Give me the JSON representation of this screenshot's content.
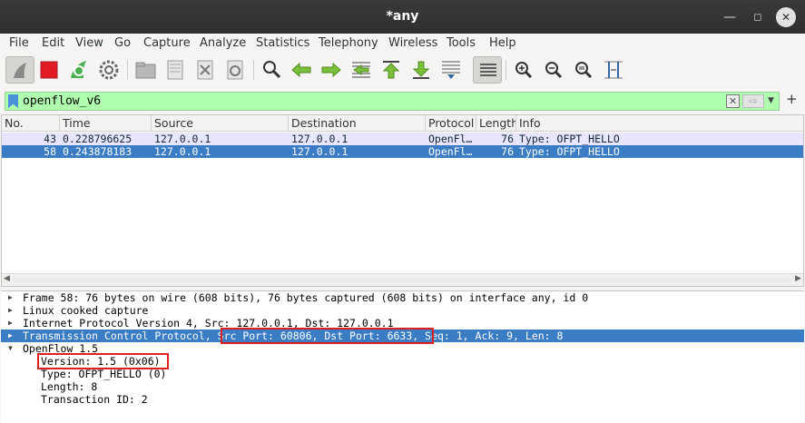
{
  "window": {
    "title": "*any"
  },
  "menu": [
    "File",
    "Edit",
    "View",
    "Go",
    "Capture",
    "Analyze",
    "Statistics",
    "Telephony",
    "Wireless",
    "Tools",
    "Help"
  ],
  "filter": {
    "value": "openflow_v6"
  },
  "packet_list": {
    "columns": [
      "No.",
      "Time",
      "Source",
      "Destination",
      "Protocol",
      "Length",
      "Info"
    ],
    "rows": [
      {
        "no": "43",
        "time": "0.228796625",
        "source": "127.0.0.1",
        "destination": "127.0.0.1",
        "protocol": "OpenFl…",
        "length": "76",
        "info": "Type: OFPT_HELLO"
      },
      {
        "no": "58",
        "time": "0.243878183",
        "source": "127.0.0.1",
        "destination": "127.0.0.1",
        "protocol": "OpenFl…",
        "length": "76",
        "info": "Type: OFPT_HELLO"
      }
    ],
    "selected_row": 1
  },
  "details": {
    "frame": "Frame 58: 76 bytes on wire (608 bits), 76 bytes captured (608 bits) on interface any, id 0",
    "linux": "Linux cooked capture",
    "ip": "Internet Protocol Version 4, Src: 127.0.0.1, Dst: 127.0.0.1",
    "tcp_prefix": "Transmission Control Protocol, ",
    "tcp_ports": "Src Port: 60806, Dst Port: 6633,",
    "tcp_suffix": " Seq: 1, Ack: 9, Len: 8",
    "openflow": "OpenFlow 1.5",
    "version": "Version: 1.5 (0x06)",
    "type": "Type: OFPT_HELLO (0)",
    "length": "Length: 8",
    "xid": "Transaction ID: 2"
  },
  "colors": {
    "selected": "#3b7dc4",
    "filter_bg": "#afffaf",
    "row_bg": "#e8e6ff",
    "highlight_box": "#e02020"
  },
  "toolbar_icons": [
    "start-capture-icon",
    "stop-capture-icon",
    "restart-capture-icon",
    "capture-options-icon",
    "open-file-icon",
    "save-file-icon",
    "close-file-icon",
    "reload-file-icon",
    "find-packet-icon",
    "go-back-icon",
    "go-forward-icon",
    "go-to-packet-icon",
    "go-first-icon",
    "go-last-icon",
    "autoscroll-icon",
    "colorize-icon",
    "zoom-in-icon",
    "zoom-out-icon",
    "normal-size-icon",
    "resize-columns-icon"
  ]
}
